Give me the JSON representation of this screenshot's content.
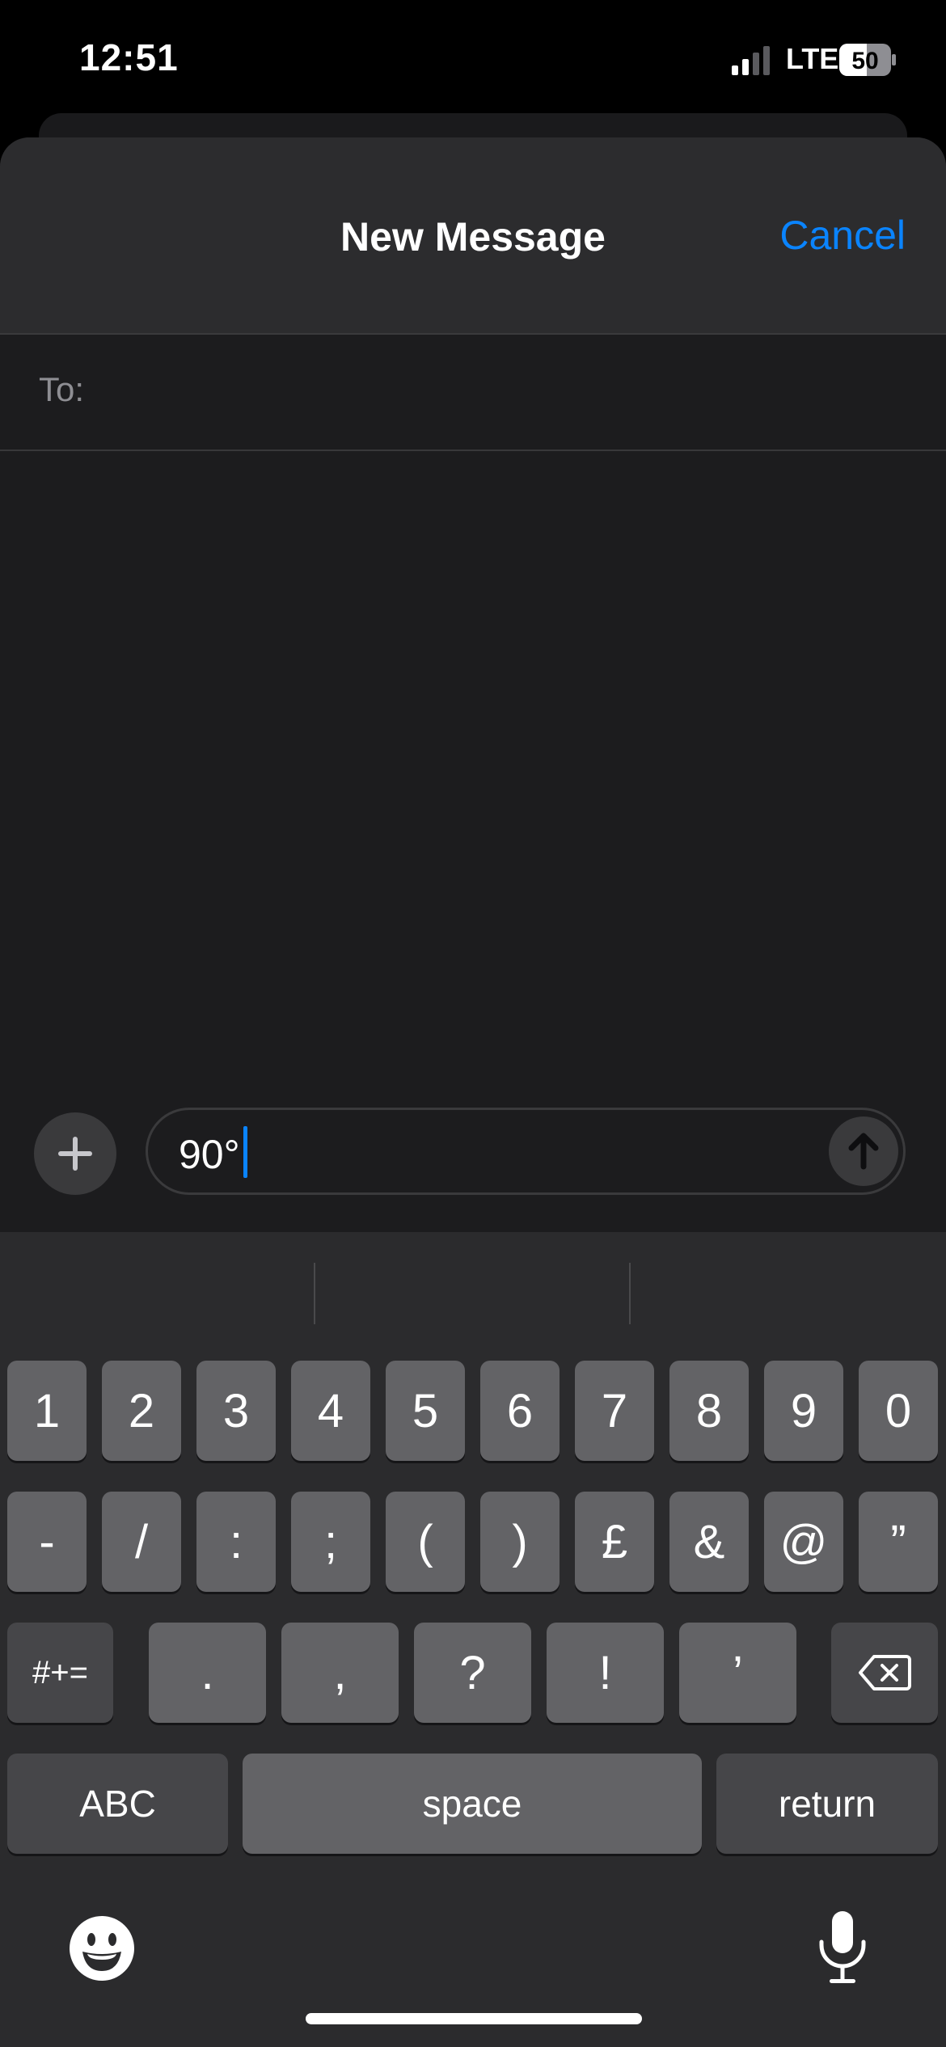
{
  "status_bar": {
    "time": "12:51",
    "network": "LTE",
    "battery": "50"
  },
  "header": {
    "title": "New Message",
    "cancel_label": "Cancel"
  },
  "recipient": {
    "label": "To:",
    "value": ""
  },
  "compose": {
    "text": "90°"
  },
  "keyboard": {
    "row1": [
      "1",
      "2",
      "3",
      "4",
      "5",
      "6",
      "7",
      "8",
      "9",
      "0"
    ],
    "row2": [
      "-",
      "/",
      ":",
      ";",
      "(",
      ")",
      "£",
      "&",
      "@",
      "”"
    ],
    "row3": [
      ".",
      ",",
      "?",
      "!",
      "’"
    ],
    "shift_label": "#+=",
    "abc_label": "ABC",
    "space_label": "space",
    "return_label": "return"
  },
  "icons": {
    "plus": "plus-icon",
    "send": "arrow-up-icon",
    "delete": "delete-backward-icon",
    "emoji": "emoji-icon",
    "mic": "microphone-icon"
  },
  "colors": {
    "accent": "#0a84ff",
    "key": "#636366",
    "key_dark": "#464649",
    "keyboard_bg": "#2b2b2d"
  }
}
